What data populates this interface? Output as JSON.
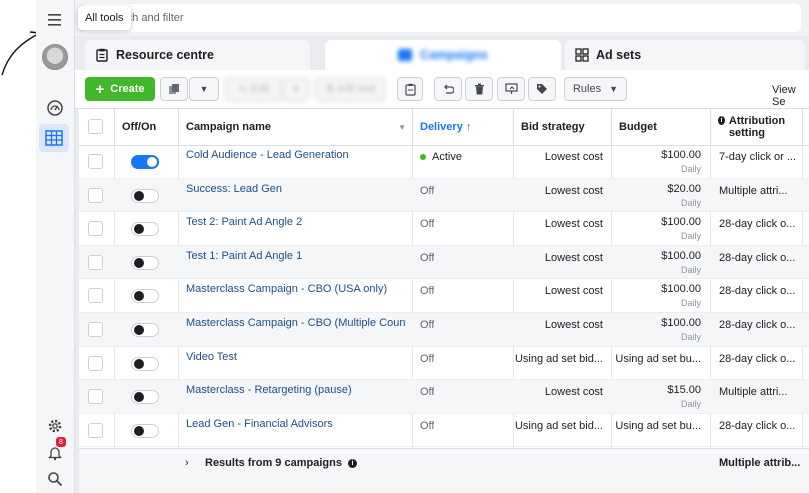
{
  "sidebar": {
    "tooltip": "All tools"
  },
  "search": {
    "placeholder_visible": "rch and filter"
  },
  "tabs": [
    {
      "label": "Resource centre"
    },
    {
      "label": "Campaigns"
    },
    {
      "label": "Ad sets"
    }
  ],
  "toolbar": {
    "create_label": "Create",
    "edit_label": "Edit",
    "abtest_label": "A/B test",
    "rules_label": "Rules",
    "view_setup_label": "View Se"
  },
  "table": {
    "headers": {
      "onoff": "Off/On",
      "campaign": "Campaign name",
      "delivery": "Delivery ↑",
      "bid": "Bid strategy",
      "budget": "Budget",
      "attribution": "Attribution setting"
    },
    "rows": [
      {
        "name": "Cold Audience - Lead Generation",
        "on": true,
        "delivery": "Active",
        "bid": "Lowest cost",
        "budget": "$100.00",
        "budget_period": "Daily",
        "attribution": "7-day click or ..."
      },
      {
        "name": "Success: Lead Gen",
        "on": false,
        "delivery": "Off",
        "bid": "Lowest cost",
        "budget": "$20.00",
        "budget_period": "Daily",
        "attribution": "Multiple attri..."
      },
      {
        "name": "Test 2: Paint Ad Angle 2",
        "on": false,
        "delivery": "Off",
        "bid": "Lowest cost",
        "budget": "$100.00",
        "budget_period": "Daily",
        "attribution": "28-day click o..."
      },
      {
        "name": "Test 1: Paint Ad Angle 1",
        "on": false,
        "delivery": "Off",
        "bid": "Lowest cost",
        "budget": "$100.00",
        "budget_period": "Daily",
        "attribution": "28-day click o..."
      },
      {
        "name": "Masterclass Campaign - CBO (USA only)",
        "on": false,
        "delivery": "Off",
        "bid": "Lowest cost",
        "budget": "$100.00",
        "budget_period": "Daily",
        "attribution": "28-day click o..."
      },
      {
        "name": "Masterclass Campaign - CBO (Multiple Count...",
        "on": false,
        "delivery": "Off",
        "bid": "Lowest cost",
        "budget": "$100.00",
        "budget_period": "Daily",
        "attribution": "28-day click o..."
      },
      {
        "name": "Video Test",
        "on": false,
        "delivery": "Off",
        "bid": "Using ad set bid...",
        "budget": "Using ad set bu...",
        "budget_period": "",
        "attribution": "28-day click o..."
      },
      {
        "name": "Masterclass - Retargeting (pause)",
        "on": false,
        "delivery": "Off",
        "bid": "Lowest cost",
        "budget": "$15.00",
        "budget_period": "Daily",
        "attribution": "Multiple attri..."
      },
      {
        "name": "Lead Gen - Financial Advisors",
        "on": false,
        "delivery": "Off",
        "bid": "Using ad set bid...",
        "budget": "Using ad set bu...",
        "budget_period": "",
        "attribution": "28-day click o..."
      }
    ],
    "footer": {
      "results": "Results from 9 campaigns",
      "attribution": "Multiple attrib..."
    }
  },
  "notifications": {
    "count": "8"
  },
  "colors": {
    "accent": "#1877f2",
    "create": "#42b72a",
    "link": "#1d4e89"
  }
}
